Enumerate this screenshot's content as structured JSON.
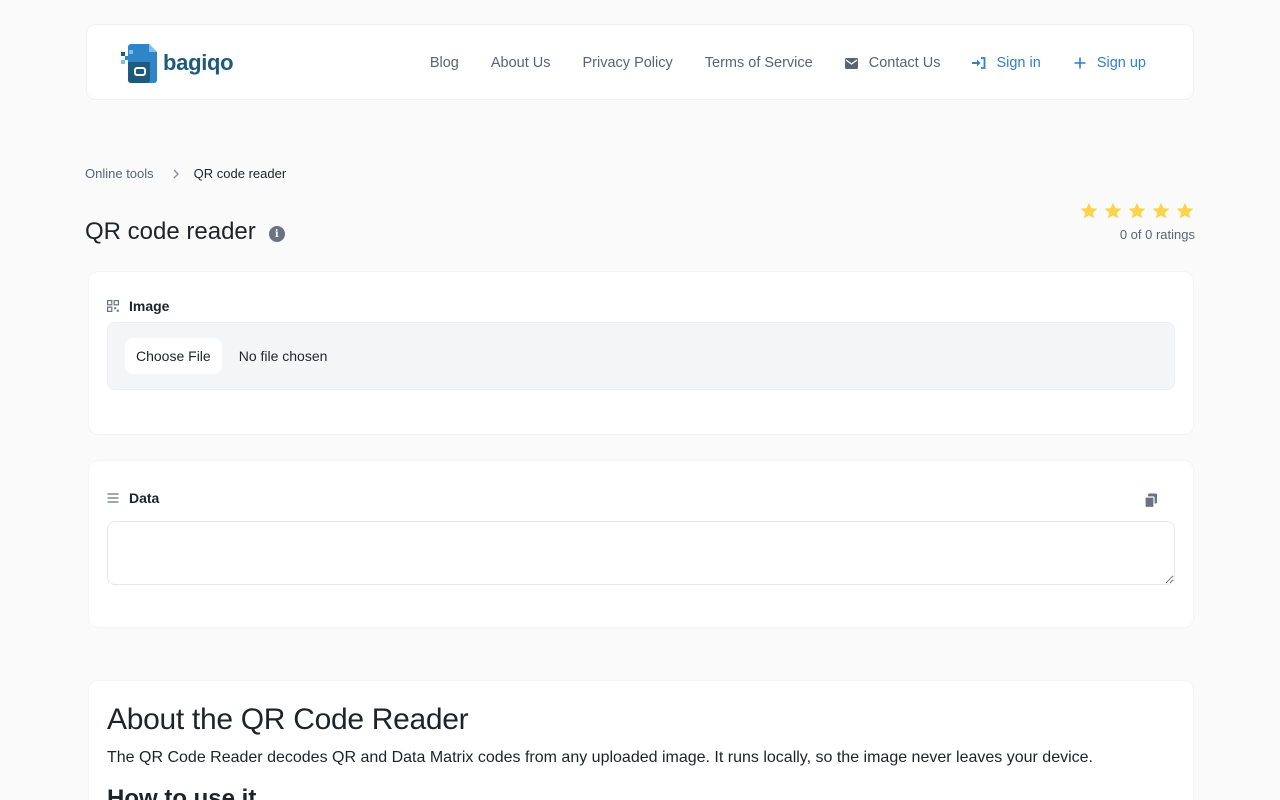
{
  "brand": {
    "name": "bagiqo"
  },
  "nav": {
    "blog": "Blog",
    "about": "About Us",
    "privacy": "Privacy Policy",
    "terms": "Terms of Service",
    "contact": "Contact Us",
    "signin": "Sign in",
    "signup": "Sign up"
  },
  "breadcrumb": {
    "parent": "Online tools",
    "current": "QR code reader"
  },
  "page": {
    "title": "QR code reader"
  },
  "rating": {
    "text": "0 of 0 ratings",
    "stars": 5,
    "value": 0
  },
  "image_card": {
    "label": "Image",
    "choose_label": "Choose File",
    "file_status": "No file chosen"
  },
  "data_card": {
    "label": "Data",
    "value": ""
  },
  "about": {
    "title": "About the QR Code Reader",
    "text": "The QR Code Reader decodes QR and Data Matrix codes from any uploaded image. It runs locally, so the image never leaves your device.",
    "subtitle": "How to use it"
  },
  "colors": {
    "accent": "#2f7fd3",
    "star": "#fcd34d",
    "brand": "#1d5a7e"
  },
  "icons": {
    "contact": "envelope-icon",
    "signin": "sign-in-icon",
    "signup": "plus-icon",
    "image": "qr-icon",
    "data": "list-icon",
    "copy": "copy-icon"
  }
}
